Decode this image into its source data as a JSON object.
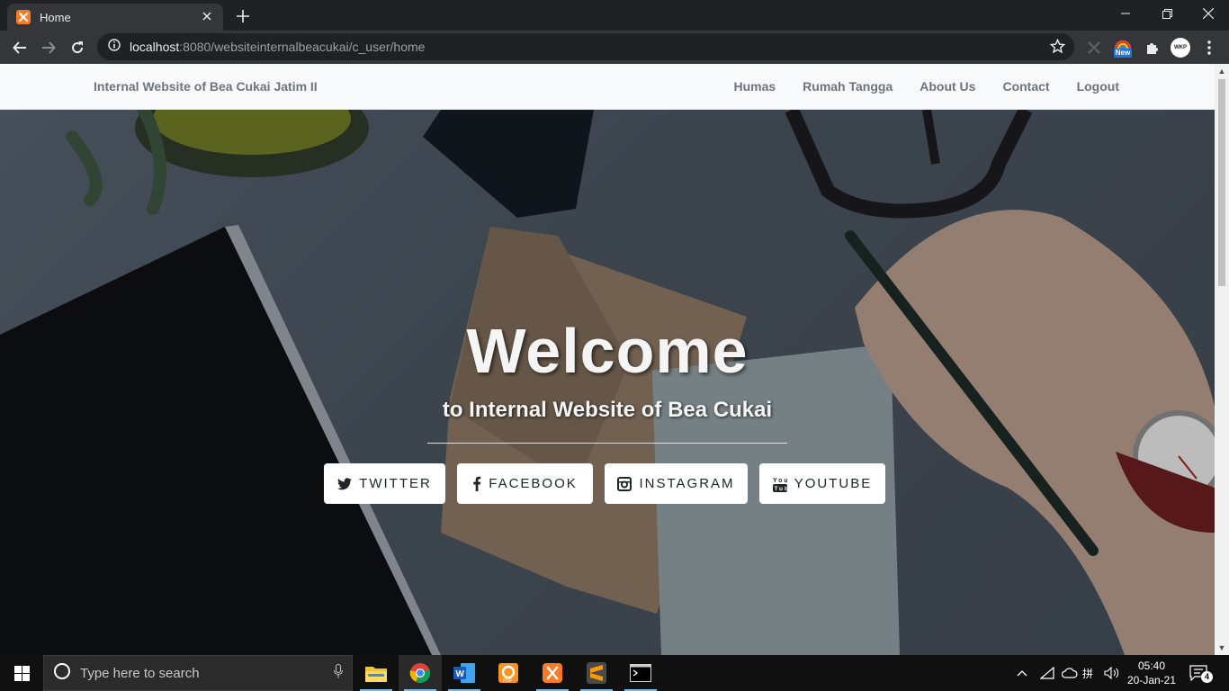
{
  "browser": {
    "tab_title": "Home",
    "url_host": "localhost",
    "url_rest": ":8080/websiteinternalbeacukai/c_user/home",
    "ext_badge": "New",
    "profile_initials": "WKP"
  },
  "navbar": {
    "brand": "Internal Website of Bea Cukai Jatim II",
    "links": [
      "Humas",
      "Rumah Tangga",
      "About Us",
      "Contact",
      "Logout"
    ]
  },
  "hero": {
    "title": "Welcome",
    "subtitle": "to Internal Website of Bea Cukai",
    "buttons": [
      "TWITTER",
      "FACEBOOK",
      "INSTAGRAM",
      "YOUTUBE"
    ]
  },
  "taskbar": {
    "search_placeholder": "Type here to search",
    "time": "05:40",
    "date": "20-Jan-21",
    "notification_count": "4",
    "ime": "拼"
  },
  "colors": {
    "chrome_dark": "#202124",
    "chrome_toolbar": "#35363a",
    "navbar_bg": "#f8f9fa",
    "navbar_text": "#6c757d",
    "taskbar": "#101010"
  },
  "icons": [
    "xampp-icon",
    "close-icon",
    "plus-icon",
    "back-icon",
    "forward-icon",
    "reload-icon",
    "info-icon",
    "star-icon",
    "puzzle-icon",
    "twitter-icon",
    "facebook-icon",
    "instagram-icon",
    "youtube-icon",
    "windows-icon",
    "cortana-icon",
    "microphone-icon",
    "file-explorer-icon",
    "chrome-icon",
    "word-icon",
    "pdf-icon",
    "sublime-icon",
    "terminal-icon",
    "wifi-icon",
    "volume-icon",
    "notification-icon"
  ]
}
